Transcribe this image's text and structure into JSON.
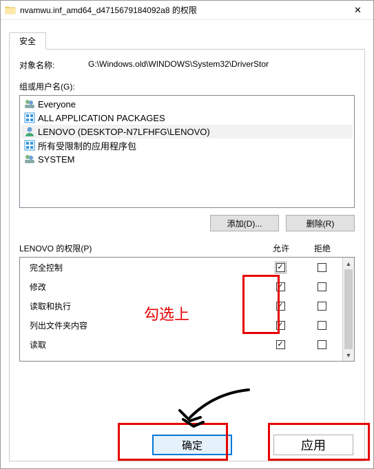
{
  "titlebar": {
    "title": "nvamwu.inf_amd64_d4715679184092a8 的权限",
    "close": "✕"
  },
  "tab": {
    "label": "安全"
  },
  "object": {
    "label": "对象名称:",
    "value": "G:\\Windows.old\\WINDOWS\\System32\\DriverStor"
  },
  "groups": {
    "label": "组或用户名(G):",
    "items": [
      {
        "icon": "group",
        "name": "Everyone"
      },
      {
        "icon": "pkg",
        "name": "ALL APPLICATION PACKAGES"
      },
      {
        "icon": "user",
        "name": "LENOVO (DESKTOP-N7LFHFG\\LENOVO)",
        "selected": true
      },
      {
        "icon": "pkg",
        "name": "所有受限制的应用程序包"
      },
      {
        "icon": "group",
        "name": "SYSTEM"
      }
    ]
  },
  "buttons": {
    "add": "添加(D)...",
    "remove": "删除(R)"
  },
  "perm": {
    "label": "LENOVO 的权限(P)",
    "col_allow": "允许",
    "col_deny": "拒绝",
    "rows": [
      {
        "name": "完全控制",
        "allow": true,
        "deny": false,
        "focus": true
      },
      {
        "name": "修改",
        "allow": true,
        "deny": false
      },
      {
        "name": "读取和执行",
        "allow": true,
        "deny": false
      },
      {
        "name": "列出文件夹内容",
        "allow": true,
        "deny": false
      },
      {
        "name": "读取",
        "allow": true,
        "deny": false
      }
    ]
  },
  "footer": {
    "ok": "确定",
    "apply": "应用"
  },
  "annotation": {
    "text": "勾选上"
  }
}
